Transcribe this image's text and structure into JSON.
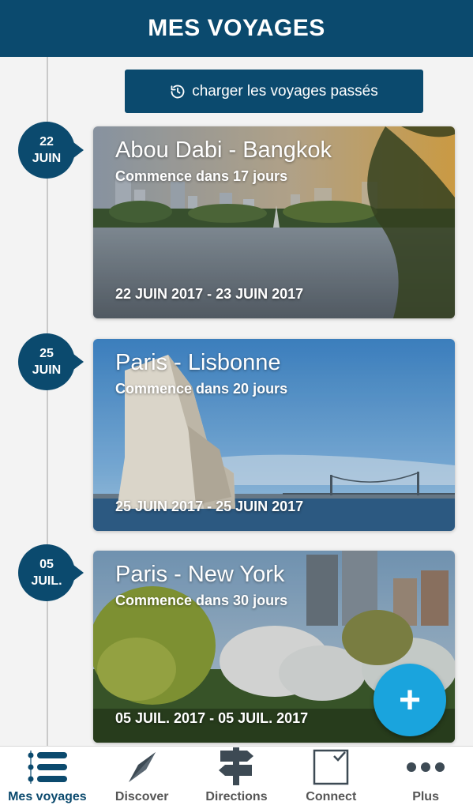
{
  "header": {
    "title": "MES VOYAGES"
  },
  "past_button": {
    "label": "charger les voyages passés",
    "icon": "history-icon"
  },
  "trips": [
    {
      "day": "22",
      "month": "JUIN",
      "title": "Abou Dabi - Bangkok",
      "subtitle": "Commence dans 17 jours",
      "dates": "22 JUIN 2017 - 23 JUIN 2017"
    },
    {
      "day": "25",
      "month": "JUIN",
      "title": "Paris - Lisbonne",
      "subtitle": "Commence dans 20 jours",
      "dates": "25 JUIN 2017 - 25 JUIN 2017"
    },
    {
      "day": "05",
      "month": "JUIL.",
      "title": "Paris - New York",
      "subtitle": "Commence dans 30 jours",
      "dates": "05 JUIL. 2017 - 05 JUIL. 2017"
    }
  ],
  "fab": {
    "label": "+"
  },
  "tabs": [
    {
      "label": "Mes voyages",
      "icon": "list-icon",
      "active": true
    },
    {
      "label": "Discover",
      "icon": "compass-icon"
    },
    {
      "label": "Directions",
      "icon": "signpost-icon"
    },
    {
      "label": "Connect",
      "icon": "checkbox-icon"
    },
    {
      "label": "Plus",
      "icon": "more-icon"
    }
  ],
  "colors": {
    "primary": "#0b4a6e",
    "accent": "#1aa4dd"
  }
}
